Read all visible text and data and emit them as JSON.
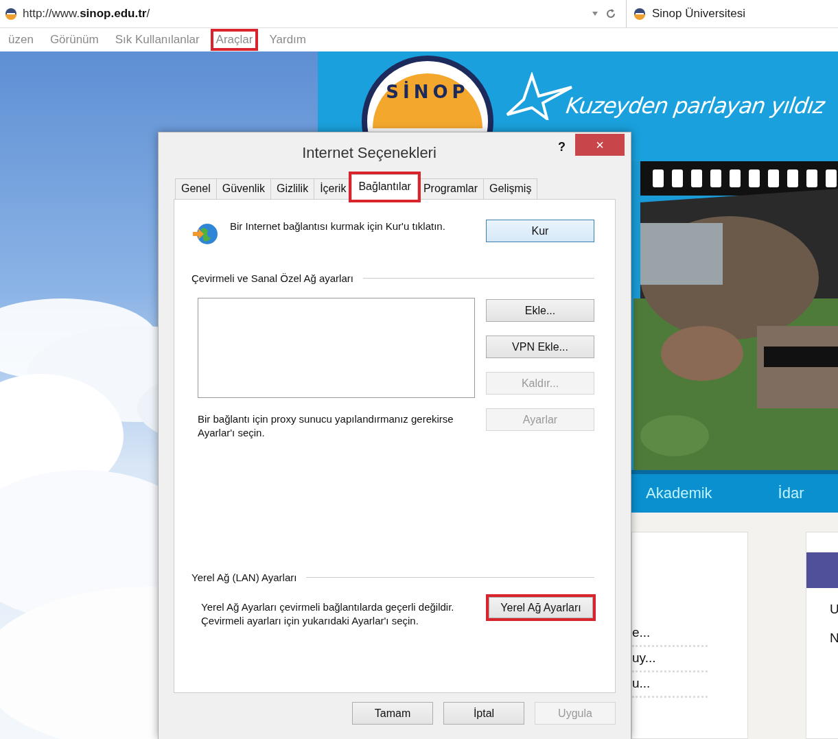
{
  "browser": {
    "address": "http://www.**sinop.edu.tr**/",
    "tab_title": "Sinop Üniversitesi",
    "menu": [
      {
        "label": "üzen",
        "highlighted": false
      },
      {
        "label": "Görünüm",
        "highlighted": false
      },
      {
        "label": "Sık Kullanılanlar",
        "highlighted": false
      },
      {
        "label": "Araçlar",
        "highlighted": true
      },
      {
        "label": "Yardım",
        "highlighted": false
      }
    ]
  },
  "website": {
    "logo_text": "SİNOP",
    "slogan": "Kuzeyden parlayan yıldız",
    "nav": [
      "Akademik",
      "İdar"
    ],
    "list_items": [
      "e...",
      "uy...",
      "u..."
    ],
    "side_items": [
      "U",
      "N"
    ]
  },
  "dialog": {
    "title": "Internet Seçenekleri",
    "help": "?",
    "close": "×",
    "tabs": [
      {
        "label": "Genel",
        "selected": false,
        "highlighted": false
      },
      {
        "label": "Güvenlik",
        "selected": false,
        "highlighted": false
      },
      {
        "label": "Gizlilik",
        "selected": false,
        "highlighted": false
      },
      {
        "label": "İçerik",
        "selected": false,
        "highlighted": false
      },
      {
        "label": "Bağlantılar",
        "selected": true,
        "highlighted": true
      },
      {
        "label": "Programlar",
        "selected": false,
        "highlighted": false
      },
      {
        "label": "Gelişmiş",
        "selected": false,
        "highlighted": false
      }
    ],
    "setup_text": "Bir Internet bağlantısı kurmak için Kur'u tıklatın.",
    "setup_button": {
      "label": "Kur",
      "disabled": false,
      "highlighted": false
    },
    "dialup_group": "Çevirmeli ve Sanal Özel Ağ ayarları",
    "dialup_buttons": [
      {
        "label": "Ekle...",
        "disabled": false,
        "highlighted": false
      },
      {
        "label": "VPN Ekle...",
        "disabled": false,
        "highlighted": false
      },
      {
        "label": "Kaldır...",
        "disabled": true,
        "highlighted": false
      },
      {
        "label": "Ayarlar",
        "disabled": true,
        "highlighted": false
      }
    ],
    "proxy_text": "Bir bağlantı için proxy sunucu yapılandırmanız gerekirse Ayarlar'ı seçin.",
    "lan_group": "Yerel Ağ (LAN) Ayarları",
    "lan_text": "Yerel Ağ Ayarları çevirmeli bağlantılarda geçerli değildir. Çevirmeli ayarları için yukarıdaki Ayarlar'ı seçin.",
    "lan_button": {
      "label": "Yerel Ağ Ayarları",
      "disabled": false,
      "highlighted": true
    },
    "footer_buttons": [
      {
        "label": "Tamam",
        "disabled": false,
        "highlighted": false
      },
      {
        "label": "İptal",
        "disabled": false,
        "highlighted": false
      },
      {
        "label": "Uygula",
        "disabled": true,
        "highlighted": false
      }
    ]
  }
}
